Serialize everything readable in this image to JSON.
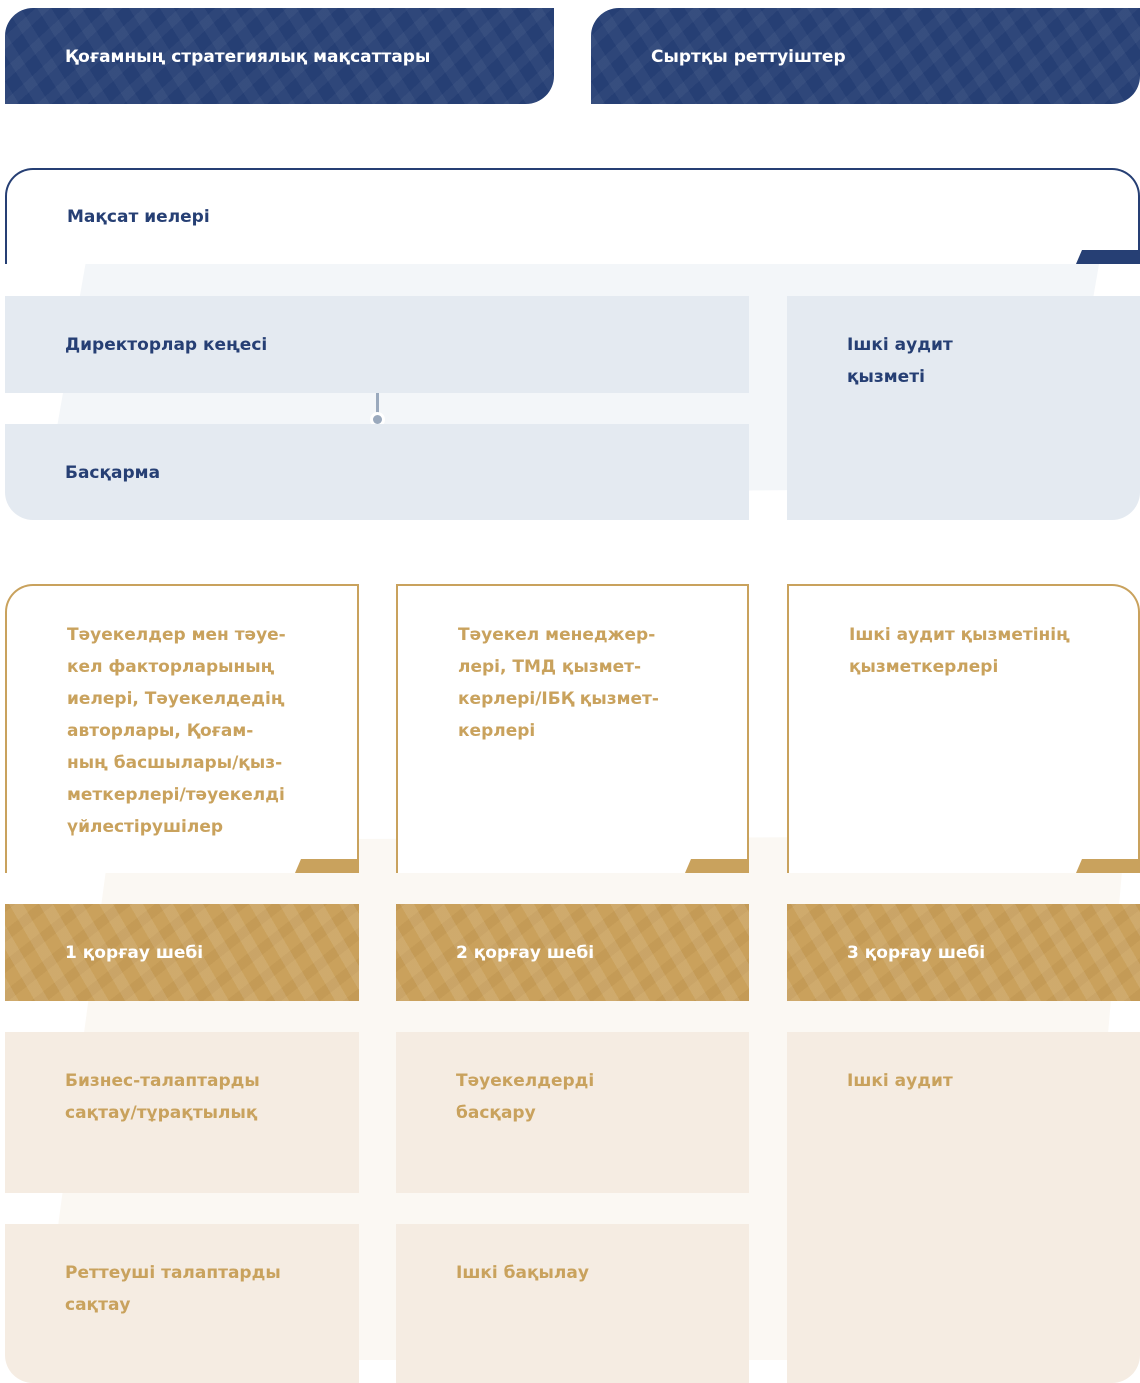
{
  "top": {
    "strategic_goals": "Қоғамның стратегиялық мақсаттары",
    "external_regulators": "Сыртқы реттуіштер"
  },
  "goal_owners": "Мақсат иелері",
  "governance": {
    "board_of_directors": "Директорлар кеңесі",
    "management_board": "Басқарма",
    "internal_audit_service": [
      "Ішкі аудит",
      "қызметі"
    ]
  },
  "roles": {
    "line1": [
      "Тәуекелдер мен тәуе-",
      "кел факторларының",
      "иелері, Тәуекелдедің",
      "авторлары, Қоғам-",
      "ның басшылары/қыз-",
      "меткерлері/тәуекелді",
      "үйлестірушілер"
    ],
    "line2": [
      "Тәуекел менеджер-",
      "лері, ТМД қызмет-",
      "керлері/ІБҚ қызмет-",
      "керлері"
    ],
    "line3": [
      "Ішкі аудит қызметінің",
      "қызметкерлері"
    ]
  },
  "lines_of_defense": {
    "line1": "1 қорғау шебі",
    "line2": "2 қорғау шебі",
    "line3": "3 қорғау шебі"
  },
  "functions": {
    "line1_a": [
      "Бизнес-талаптарды",
      "сақтау/тұрақтылық"
    ],
    "line1_b": [
      "Реттеуші талаптарды",
      "сақтау"
    ],
    "line2_a": [
      "Тәуекелдерді",
      "басқару"
    ],
    "line2_b": [
      "Ішкі бақылау"
    ],
    "line3_a": [
      "Ішкі аудит"
    ]
  },
  "colors": {
    "navy": "#263f74",
    "gold": "#caa15c",
    "light_blue": "#e4eaf1",
    "beige": "#f5ece2",
    "gold_text": "#c9a25d"
  }
}
